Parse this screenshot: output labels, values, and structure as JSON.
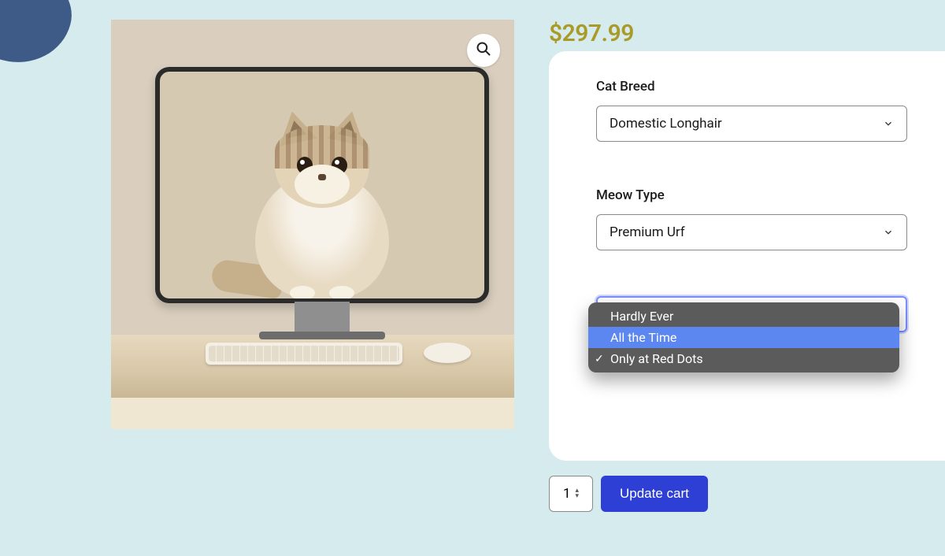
{
  "product": {
    "price": "$297.99",
    "image_alt": "Fluffy tabby cat sitting in front of a desktop monitor on a wooden desk"
  },
  "options": {
    "breed": {
      "label": "Cat Breed",
      "selected": "Domestic Longhair"
    },
    "meow": {
      "label": "Meow Type",
      "selected": "Premium Urf"
    },
    "dropdown_open": {
      "items": [
        {
          "label": "Hardly Ever",
          "checked": false,
          "highlight": false
        },
        {
          "label": "All the Time",
          "checked": false,
          "highlight": true
        },
        {
          "label": "Only at Red Dots",
          "checked": true,
          "highlight": false
        }
      ]
    }
  },
  "cart": {
    "quantity": "1",
    "button": "Update cart"
  },
  "icons": {
    "zoom": "search-icon",
    "chevron": "chevron-down-icon",
    "check": "✓"
  }
}
